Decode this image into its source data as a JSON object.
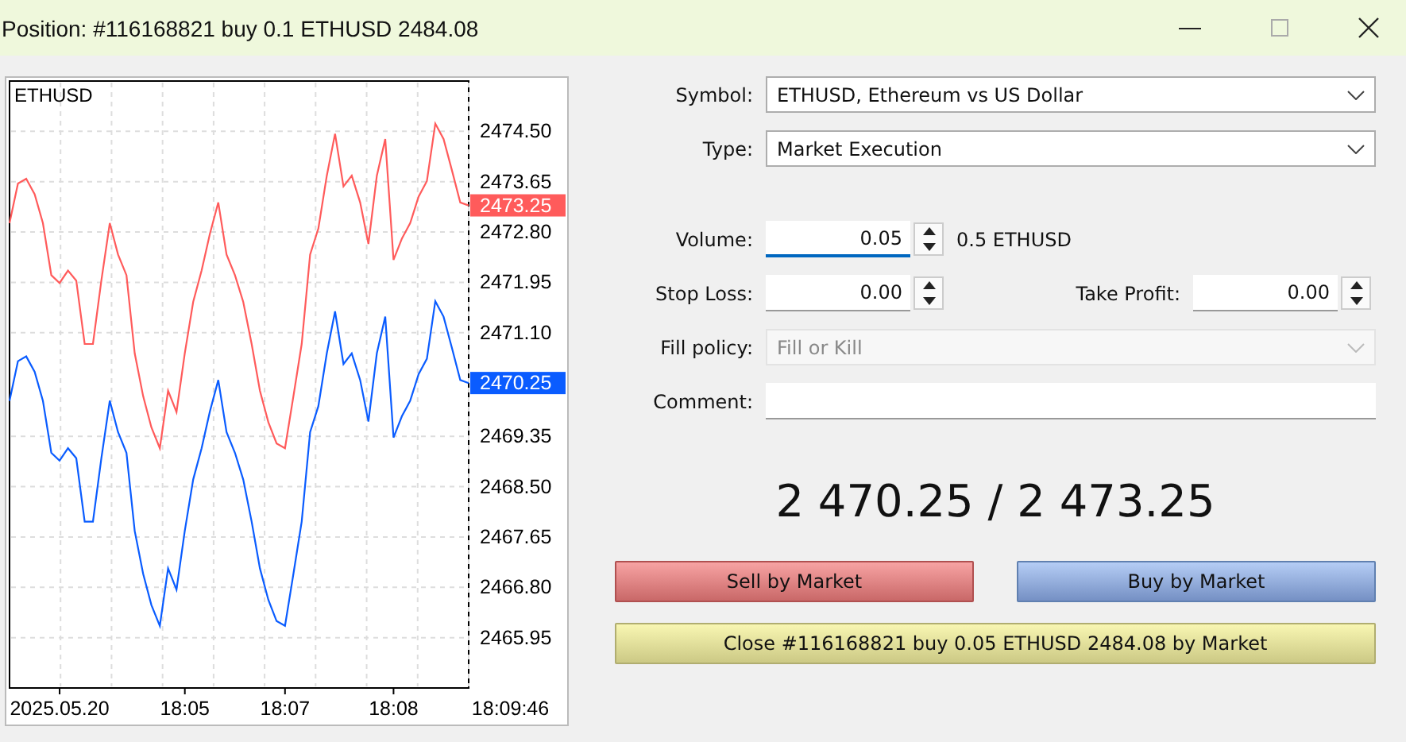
{
  "window": {
    "title": "Position: #116168821 buy 0.1 ETHUSD 2484.08"
  },
  "chart": {
    "chart_data": {
      "type": "line",
      "title": "ETHUSD",
      "ylim": [
        2465.1,
        2475.35
      ],
      "categories": [
        null,
        null,
        null,
        null,
        null,
        null,
        "2025.05.20",
        null,
        null,
        null,
        null,
        null,
        null,
        null,
        null,
        null,
        null,
        null,
        null,
        null,
        null,
        "18:05",
        null,
        null,
        null,
        null,
        null,
        null,
        null,
        null,
        null,
        null,
        null,
        "18:07",
        null,
        null,
        null,
        null,
        null,
        null,
        null,
        null,
        null,
        null,
        null,
        null,
        "18:08",
        null,
        null,
        null,
        null,
        null,
        null,
        null,
        null,
        null,
        null,
        null,
        null,
        null,
        "18:09:46"
      ],
      "series": [
        {
          "color": "#ff5b5b",
          "values": [
            2472.95,
            2473.62,
            2473.7,
            2473.44,
            2472.95,
            2472.07,
            2471.94,
            2472.15,
            2471.98,
            2470.91,
            2470.91,
            2471.98,
            2472.95,
            2472.42,
            2472.07,
            2470.75,
            2470.03,
            2469.5,
            2469.15,
            2470.12,
            2469.76,
            2470.75,
            2471.62,
            2472.15,
            2472.77,
            2473.3,
            2472.42,
            2472.07,
            2471.62,
            2470.91,
            2470.12,
            2469.59,
            2469.23,
            2469.15,
            2470.03,
            2470.91,
            2472.42,
            2472.86,
            2473.75,
            2474.46,
            2473.57,
            2473.75,
            2473.3,
            2472.6,
            2473.75,
            2474.37,
            2472.33,
            2472.69,
            2472.95,
            2473.4,
            2473.66,
            2474.63,
            2474.37,
            2473.84,
            2473.3,
            2473.25,
            null,
            null,
            null,
            null,
            null
          ]
        },
        {
          "color": "#0a5cff",
          "values": [
            2469.95,
            2470.62,
            2470.7,
            2470.44,
            2469.95,
            2469.07,
            2468.94,
            2469.15,
            2468.98,
            2467.91,
            2467.91,
            2468.98,
            2469.95,
            2469.42,
            2469.07,
            2467.75,
            2467.03,
            2466.5,
            2466.15,
            2467.12,
            2466.76,
            2467.75,
            2468.62,
            2469.15,
            2469.77,
            2470.3,
            2469.42,
            2469.07,
            2468.62,
            2467.91,
            2467.12,
            2466.59,
            2466.23,
            2466.15,
            2467.03,
            2467.91,
            2469.42,
            2469.86,
            2470.75,
            2471.46,
            2470.57,
            2470.75,
            2470.3,
            2469.6,
            2470.75,
            2471.37,
            2469.33,
            2469.69,
            2469.95,
            2470.4,
            2470.66,
            2471.63,
            2471.37,
            2470.84,
            2470.3,
            2470.25,
            null,
            null,
            null,
            null,
            null
          ]
        }
      ],
      "grid": true,
      "yticks": [
        {
          "value": 2474.5,
          "label": "2474.50"
        },
        {
          "value": 2473.65,
          "label": "2473.65"
        },
        {
          "value": 2472.8,
          "label": "2472.80"
        },
        {
          "value": 2471.95,
          "label": "2471.95"
        },
        {
          "value": 2471.1,
          "label": "2471.10"
        },
        {
          "value": 2469.35,
          "label": "2469.35"
        },
        {
          "value": 2468.5,
          "label": "2468.50"
        },
        {
          "value": 2467.65,
          "label": "2467.65"
        },
        {
          "value": 2466.8,
          "label": "2466.80"
        },
        {
          "value": 2465.95,
          "label": "2465.95"
        }
      ],
      "annotations": [
        "2473.25",
        "2470.25"
      ]
    }
  },
  "form": {
    "symbol": {
      "label": "Symbol:",
      "value": "ETHUSD, Ethereum vs US Dollar"
    },
    "type": {
      "label": "Type:",
      "value": "Market Execution"
    },
    "volume": {
      "label": "Volume:",
      "value": "0.05",
      "note": "0.5 ETHUSD",
      "focused": true
    },
    "stop_loss": {
      "label": "Stop Loss:",
      "value": "0.00",
      "focused": false
    },
    "take_profit": {
      "label": "Take Profit:",
      "value": "0.00",
      "focused": false
    },
    "fill_policy": {
      "label": "Fill policy:",
      "value": "Fill or Kill",
      "disabled": true
    },
    "comment": {
      "label": "Comment:"
    }
  },
  "quote": "2 470.25 / 2 473.25",
  "buttons": [
    {
      "label": "Sell by Market",
      "kind": "sell"
    },
    {
      "label": "Buy by Market",
      "kind": "buy"
    },
    {
      "label": "Close #116168821 buy 0.05 ETHUSD 2484.08 by Market",
      "kind": "close"
    }
  ]
}
